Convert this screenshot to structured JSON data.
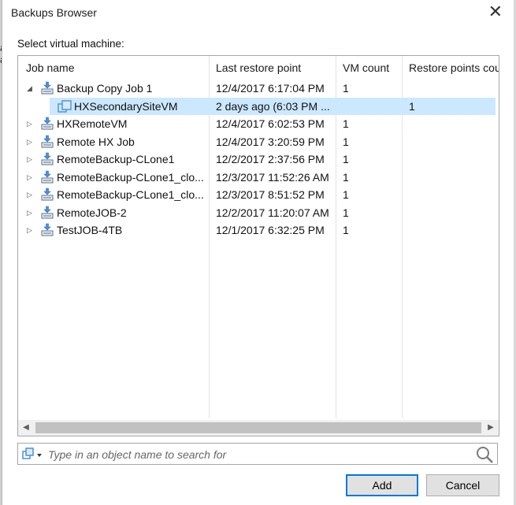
{
  "window": {
    "title": "Backups Browser",
    "close_glyph": "✕"
  },
  "background": {
    "left_peek_1": "a",
    "left_peek_2": "a",
    "right_peek": "s"
  },
  "select_label": "Select virtual machine:",
  "columns": [
    "Job name",
    "Last restore point",
    "VM count",
    "Restore points cou"
  ],
  "rows": [
    {
      "name": "Backup Copy Job 1",
      "last": "12/4/2017 6:17:04 PM",
      "vms": "1",
      "points": "",
      "expander": "◢",
      "icon": "job-icon"
    },
    {
      "name": "HXSecondarySiteVM",
      "last": "2 days ago (6:03 PM ...",
      "vms": "",
      "points": "1",
      "expander": "",
      "icon": "vm-icon",
      "selected": true
    },
    {
      "name": "HXRemoteVM",
      "last": "12/4/2017 6:02:53 PM",
      "vms": "1",
      "points": "",
      "expander": "▷",
      "icon": "job-icon"
    },
    {
      "name": "Remote HX Job",
      "last": "12/4/2017 3:20:59 PM",
      "vms": "1",
      "points": "",
      "expander": "▷",
      "icon": "job-icon"
    },
    {
      "name": "RemoteBackup-CLone1",
      "last": "12/2/2017 2:37:56 PM",
      "vms": "1",
      "points": "",
      "expander": "▷",
      "icon": "job-icon"
    },
    {
      "name": "RemoteBackup-CLone1_clo...",
      "last": "12/3/2017 11:52:26 AM",
      "vms": "1",
      "points": "",
      "expander": "▷",
      "icon": "job-icon"
    },
    {
      "name": "RemoteBackup-CLone1_clo...",
      "last": "12/3/2017 8:51:52 PM",
      "vms": "1",
      "points": "",
      "expander": "▷",
      "icon": "job-icon"
    },
    {
      "name": "RemoteJOB-2",
      "last": "12/2/2017 11:20:07 AM",
      "vms": "1",
      "points": "",
      "expander": "▷",
      "icon": "job-icon"
    },
    {
      "name": "TestJOB-4TB",
      "last": "12/1/2017 6:32:25 PM",
      "vms": "1",
      "points": "",
      "expander": "▷",
      "icon": "job-icon"
    }
  ],
  "scrollbar": {
    "left_arrow": "◀",
    "right_arrow": "▶"
  },
  "search": {
    "placeholder": "Type in an object name to search for",
    "value": ""
  },
  "buttons": {
    "add": "Add",
    "cancel": "Cancel"
  },
  "colors": {
    "selection": "#cce8ff",
    "accent": "#0078d7",
    "icon_blue": "#4a90d9"
  }
}
